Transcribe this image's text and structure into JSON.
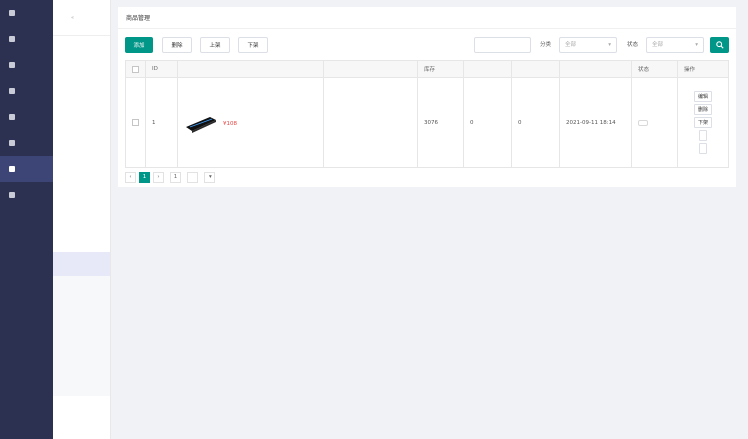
{
  "nav1": {
    "items": [
      {
        "label": "",
        "icon": "monitor-icon"
      },
      {
        "label": "",
        "icon": "gear-icon"
      },
      {
        "label": "",
        "icon": "grid-icon"
      },
      {
        "label": "",
        "icon": "user-icon"
      },
      {
        "label": "",
        "icon": "mail-icon"
      },
      {
        "label": "",
        "icon": "finance-icon"
      },
      {
        "label": "",
        "icon": "megaphone-icon",
        "active": true
      },
      {
        "label": "",
        "icon": "extension-icon"
      }
    ]
  },
  "nav2": {
    "title": "",
    "items": [
      {
        "label": "",
        "kind": "item"
      },
      {
        "label": "",
        "kind": "item"
      },
      {
        "label": "",
        "kind": "item"
      },
      {
        "label": "",
        "kind": "item"
      },
      {
        "label": "",
        "kind": "item"
      },
      {
        "label": "",
        "kind": "group"
      },
      {
        "label": "",
        "kind": "group"
      },
      {
        "label": "",
        "kind": "group"
      },
      {
        "label": "",
        "kind": "group"
      },
      {
        "label": "",
        "kind": "sub",
        "active": true
      },
      {
        "label": "",
        "kind": "sub"
      },
      {
        "label": "",
        "kind": "sub"
      },
      {
        "label": "",
        "kind": "sub"
      },
      {
        "label": "",
        "kind": "sub"
      },
      {
        "label": "",
        "kind": "sub"
      },
      {
        "label": "",
        "kind": "group"
      },
      {
        "label": "",
        "kind": "group"
      }
    ]
  },
  "main": {
    "title": "商品管理"
  },
  "toolbar": {
    "add": "添加",
    "delete": "删除",
    "shelve": "上架",
    "unshelve": "下架",
    "name_label": "",
    "name_placeholder": "",
    "category_label": "分类",
    "category_value": "全部",
    "status_label": "状态",
    "status_value": "全部"
  },
  "table": {
    "headers": [
      "",
      "ID",
      "",
      "",
      "库存",
      "",
      "",
      "",
      "状态",
      "操作"
    ],
    "row": {
      "id": "1",
      "title": "",
      "price": "¥108",
      "tiers": [
        {
          "text": "",
          "highlight": "",
          "rest": ""
        },
        {
          "text": "",
          "highlight": "",
          "rest": ""
        },
        {
          "text": "",
          "highlight": "",
          "rest": ""
        }
      ],
      "stock": "3076",
      "joined": "0",
      "sort": "0",
      "created": "2021-09-11 18:14",
      "status": "",
      "ops": [
        "编辑",
        "删除",
        "下架",
        "",
        ""
      ]
    }
  },
  "pager": {
    "current": "1",
    "goto_label": "",
    "goto_value": "1",
    "page_unit": "",
    "confirm": "",
    "total": "",
    "per_page": ""
  },
  "colors": {
    "primary": "#009688",
    "sidebar": "#2c3151",
    "price": "#e64340"
  }
}
